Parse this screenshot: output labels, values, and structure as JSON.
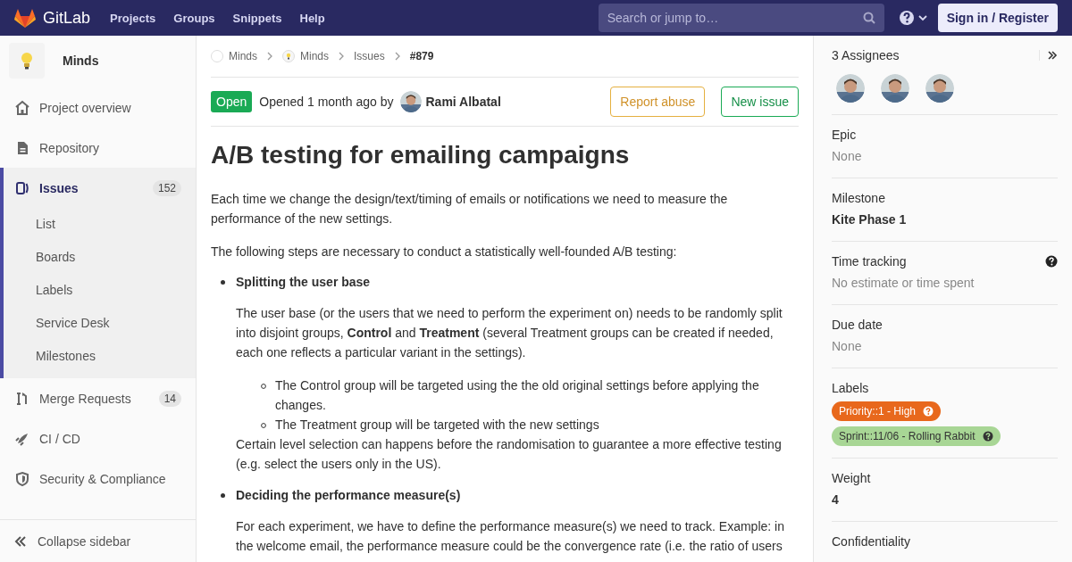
{
  "top_bar": {
    "brand": "GitLab",
    "menu": [
      "Projects",
      "Groups",
      "Snippets",
      "Help"
    ],
    "search": {
      "placeholder": "Search or jump to…"
    },
    "sign_in": "Sign in / Register"
  },
  "sidebar": {
    "project": "Minds",
    "items": [
      {
        "label": "Project overview",
        "selected": false
      },
      {
        "label": "Repository",
        "selected": false
      },
      {
        "label": "Issues",
        "selected": true,
        "count": "152",
        "children": [
          "List",
          "Boards",
          "Labels",
          "Service Desk",
          "Milestones"
        ]
      },
      {
        "label": "Merge Requests",
        "selected": false,
        "count": "14"
      },
      {
        "label": "CI / CD",
        "selected": false
      },
      {
        "label": "Security & Compliance",
        "selected": false
      }
    ],
    "collapse": "Collapse sidebar"
  },
  "breadcrumb": [
    {
      "label": "Minds",
      "current": false
    },
    {
      "label": "Minds",
      "current": false
    },
    {
      "label": "Issues",
      "current": false
    },
    {
      "label": "#879",
      "current": true
    }
  ],
  "issue": {
    "status": "Open",
    "opened": "Opened 1 month ago by",
    "author": "Rami Albatal",
    "buttons": [
      {
        "label": "Report abuse",
        "kind": "warning"
      },
      {
        "label": "New issue",
        "kind": "success"
      }
    ],
    "title": "A/B testing for emailing campaigns",
    "description": [
      {
        "kind": "paragraph",
        "text": "Each time we change the design/text/timing of emails or notifications we need to measure the performance of the new settings."
      },
      {
        "kind": "paragraph",
        "text": "The following steps are necessary to conduct a statistically well-founded A/B testing:"
      },
      {
        "kind": "step",
        "title": "Splitting the user base",
        "blocks": [
          {
            "kind": "paragraph",
            "text": "The user base (or the users that we need to perform the experiment on) needs to be randomly split into disjoint groups, **Control** and **Treatment** (several Treatment groups can be created if needed, each one reflects a particular variant in the settings)."
          },
          {
            "kind": "bullets",
            "items": [
              "The Control group will be targeted using the the old original settings before applying the changes.",
              "The Treatment group will be targeted with the new settings"
            ]
          },
          {
            "kind": "note",
            "text": "Certain level selection can happens before the randomisation to guarantee a more effective testing (e.g. select the users only in the US)."
          }
        ]
      },
      {
        "kind": "step",
        "title": "Deciding the performance measure(s)",
        "blocks": [
          {
            "kind": "paragraph",
            "text": "For each experiment, we have to define the performance measure(s) we need to track. Example: in the welcome email, the performance measure could be the convergence rate (i.e. the ratio of users"
          }
        ]
      }
    ]
  },
  "right_sidebar": {
    "assignees_title": "3 Assignees",
    "sections": [
      {
        "title": "Epic",
        "kind": "muted",
        "value": "None"
      },
      {
        "title": "Milestone",
        "kind": "strong",
        "value": "Kite Phase 1"
      },
      {
        "title": "Time tracking",
        "kind": "muted",
        "value": "No estimate or time spent",
        "help": true
      },
      {
        "title": "Due date",
        "kind": "muted",
        "value": "None"
      },
      {
        "title": "Labels",
        "kind": "labels",
        "labels": [
          {
            "text": "Priority::1 - High",
            "color": "#e8681c"
          },
          {
            "text": "Sprint::11/06 - Rolling Rabbit",
            "color": "#a8d695"
          }
        ]
      },
      {
        "title": "Weight",
        "kind": "strong",
        "value": "4"
      },
      {
        "title": "Confidentiality",
        "kind": "none"
      }
    ]
  }
}
